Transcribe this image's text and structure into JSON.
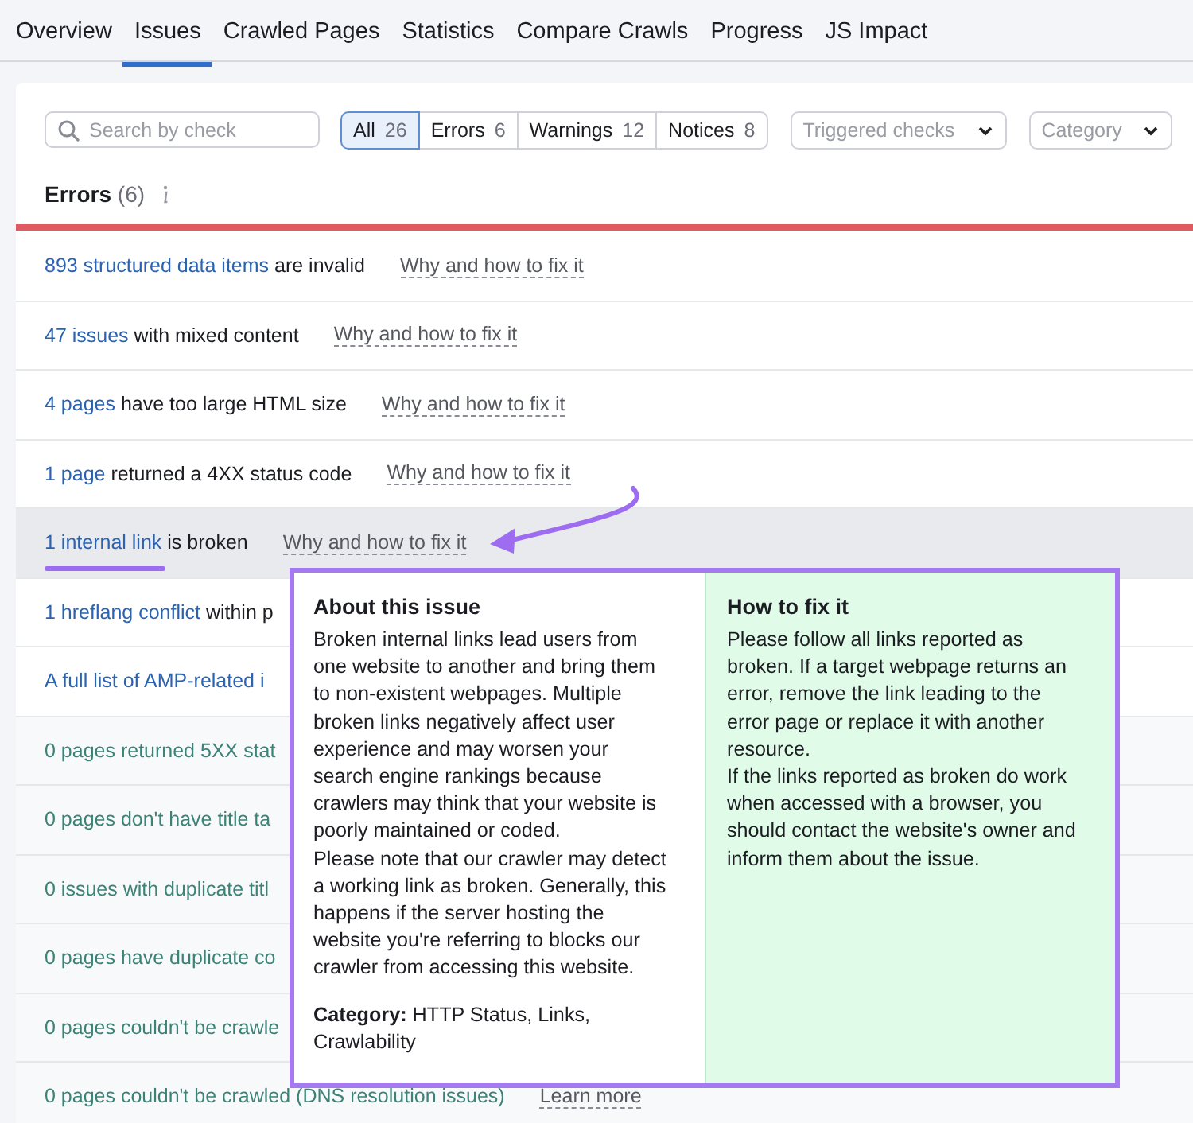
{
  "tabs": [
    {
      "label": "Overview",
      "selected": false
    },
    {
      "label": "Issues",
      "selected": true
    },
    {
      "label": "Crawled Pages",
      "selected": false
    },
    {
      "label": "Statistics",
      "selected": false
    },
    {
      "label": "Compare Crawls",
      "selected": false
    },
    {
      "label": "Progress",
      "selected": false
    },
    {
      "label": "JS Impact",
      "selected": false
    }
  ],
  "search": {
    "placeholder": "Search by check"
  },
  "filters": [
    {
      "label": "All",
      "count": "26",
      "selected": true
    },
    {
      "label": "Errors",
      "count": "6",
      "selected": false
    },
    {
      "label": "Warnings",
      "count": "12",
      "selected": false
    },
    {
      "label": "Notices",
      "count": "8",
      "selected": false
    }
  ],
  "dropdowns": [
    {
      "placeholder": "Triggered checks"
    },
    {
      "placeholder": "Category"
    }
  ],
  "section": {
    "title": "Errors",
    "count": "(6)"
  },
  "rows": [
    {
      "kind": "error",
      "link": "893 structured data items",
      "text": " are invalid",
      "help": "Why and how to fix it",
      "highlighted": false
    },
    {
      "kind": "error",
      "link": "47 issues",
      "text": " with mixed content",
      "help": "Why and how to fix it",
      "highlighted": false
    },
    {
      "kind": "error",
      "link": "4 pages",
      "text": " have too large HTML size",
      "help": "Why and how to fix it",
      "highlighted": false
    },
    {
      "kind": "error",
      "link": "1 page",
      "text": " returned a 4XX status code",
      "help": "Why and how to fix it",
      "highlighted": false
    },
    {
      "kind": "error",
      "link": "1 internal link",
      "text": " is broken",
      "help": "Why and how to fix it",
      "highlighted": true
    },
    {
      "kind": "error",
      "link": "1 hreflang conflict",
      "text": " within p",
      "highlighted": false
    },
    {
      "kind": "error",
      "link": "A full list of AMP-related i",
      "highlighted": false
    },
    {
      "kind": "empty",
      "link": "0 pages returned 5XX stat",
      "highlighted": false
    },
    {
      "kind": "empty",
      "link": "0 pages don't have title ta",
      "highlighted": false
    },
    {
      "kind": "empty",
      "link": "0 issues with duplicate titl",
      "highlighted": false
    },
    {
      "kind": "empty",
      "link": "0 pages have duplicate co",
      "highlighted": false
    },
    {
      "kind": "empty",
      "link": "0 pages couldn't be crawle",
      "highlighted": false
    },
    {
      "kind": "empty",
      "link": "0 pages couldn't be crawled (DNS resolution issues)",
      "help": "Learn more",
      "highlighted": false
    }
  ],
  "popup": {
    "about": {
      "title": "About this issue",
      "paragraphs": [
        "Broken internal links lead users from one website to another and bring them to non-existent webpages. Multiple broken links negatively affect user experience and may worsen your search engine rankings because crawlers may think that your website is poorly maintained or coded.",
        "Please note that our crawler may detect a working link as broken. Generally, this happens if the server hosting the website you're referring to blocks our crawler from accessing this website."
      ],
      "category": "**Category:** HTTP Status, Links, Crawlability"
    },
    "fix": {
      "title": "How to fix it",
      "paragraphs": [
        "Please follow all links reported as broken. If a target webpage returns an error, remove the link leading to the error page or replace it with another resource.",
        "If the links reported as broken do work when accessed with a browser, you should contact the website's owner and inform them about the issue."
      ]
    }
  }
}
